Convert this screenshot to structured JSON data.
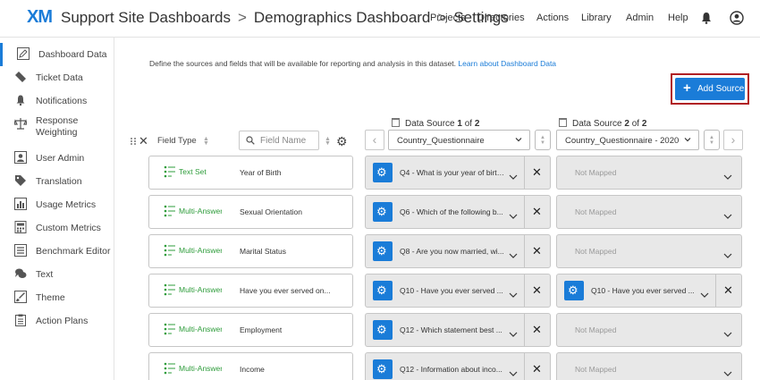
{
  "app": {
    "logo": "XM",
    "breadcrumbs": [
      "Support Site Dashboards",
      "Demographics Dashboard",
      "Settings"
    ],
    "nav": [
      "Projects",
      "Directories",
      "Actions",
      "Library",
      "Admin",
      "Help"
    ]
  },
  "sidebar": {
    "items": [
      {
        "label": "Dashboard Data",
        "icon": "pencil-icon",
        "active": true
      },
      {
        "label": "Ticket Data",
        "icon": "ticket-icon"
      },
      {
        "label": "Notifications",
        "icon": "bell-icon"
      },
      {
        "label": "Response Weighting",
        "icon": "scale-icon"
      },
      {
        "label": "User Admin",
        "icon": "user-icon"
      },
      {
        "label": "Translation",
        "icon": "tag-icon"
      },
      {
        "label": "Usage Metrics",
        "icon": "bar-chart-icon"
      },
      {
        "label": "Custom Metrics",
        "icon": "calculator-icon"
      },
      {
        "label": "Benchmark Editor",
        "icon": "list-icon"
      },
      {
        "label": "Text",
        "icon": "chat-icon"
      },
      {
        "label": "Theme",
        "icon": "paint-brush-icon"
      },
      {
        "label": "Action Plans",
        "icon": "clipboard-icon"
      }
    ]
  },
  "main": {
    "description": "Define the sources and fields that will be available for reporting and analysis in this dataset.",
    "learn_link": "Learn about Dashboard Data",
    "add_source": "Add Source",
    "field_type_header": "Field Type",
    "field_name_placeholder": "Field Name",
    "sources": [
      {
        "prefix": "Data Source ",
        "num": "1",
        "of": " of ",
        "total": "2",
        "selected": "Country_Questionnaire"
      },
      {
        "prefix": "Data Source ",
        "num": "2",
        "of": " of ",
        "total": "2",
        "selected": "Country_Questionnaire - 2020"
      }
    ],
    "rows": [
      {
        "type": "Text Set",
        "field": "Year of Birth",
        "map1": "Q4 - What is your year of birth?",
        "map2": "Not Mapped"
      },
      {
        "type": "Multi-Answer",
        "field": "Sexual Orientation",
        "map1": "Q6 - Which of the following b...",
        "map2": "Not Mapped"
      },
      {
        "type": "Multi-Answer",
        "field": "Marital Status",
        "map1": "Q8 - Are you now married, wi...",
        "map2": "Not Mapped"
      },
      {
        "type": "Multi-Answer",
        "field": "Have you ever served on...",
        "map1": "Q10 - Have you ever served ...",
        "map2": "Q10 - Have you ever served ..."
      },
      {
        "type": "Multi-Answer",
        "field": "Employment",
        "map1": "Q12 - Which statement best ...",
        "map2": "Not Mapped"
      },
      {
        "type": "Multi-Answer",
        "field": "Income",
        "map1": "Q12 - Information about inco...",
        "map2": "Not Mapped"
      }
    ]
  },
  "colors": {
    "accent": "#1a7cd8",
    "highlight_border": "#b01f24",
    "type_green": "#2e9c3b"
  }
}
